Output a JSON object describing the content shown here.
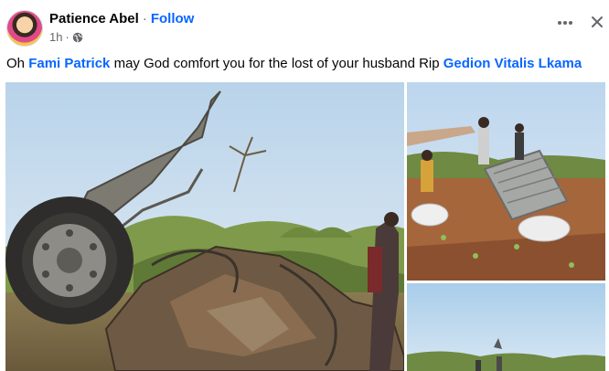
{
  "post": {
    "author": "Patience Abel",
    "separator": "·",
    "follow_label": "Follow",
    "timestamp": "1h",
    "meta_separator": "·",
    "privacy_icon": "globe-icon",
    "text": {
      "prefix": "Oh ",
      "mention_1": "Fami Patrick",
      "middle": " may God comfort you for the lost of your husband Rip ",
      "mention_2": "Gedion Vitalis Lkama"
    }
  },
  "controls": {
    "more_icon": "more-options-icon",
    "close_icon": "close-icon"
  },
  "colors": {
    "link": "#0866ff",
    "secondary_text": "#65676b",
    "primary_text": "#050505"
  }
}
